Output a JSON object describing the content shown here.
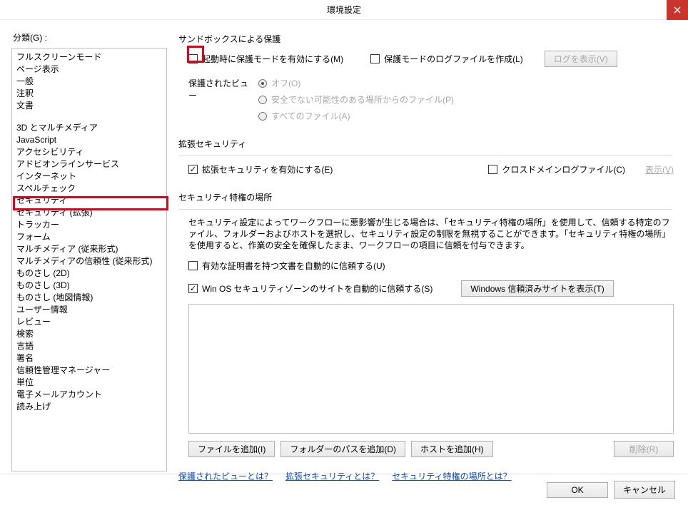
{
  "title": "環境設定",
  "category_label": "分類(G) :",
  "categories_group1": [
    "フルスクリーンモード",
    "ページ表示",
    "一般",
    "注釈",
    "文書"
  ],
  "categories_group2": [
    "3D とマルチメディア",
    "JavaScript",
    "アクセシビリティ",
    "アドビオンラインサービス",
    "インターネット",
    "スペルチェック",
    "セキュリティ",
    "セキュリティ (拡張)",
    "トラッカー",
    "フォーム",
    "マルチメディア (従来形式)",
    "マルチメディアの信頼性 (従来形式)",
    "ものさし (2D)",
    "ものさし (3D)",
    "ものさし (地図情報)",
    "ユーザー情報",
    "レビュー",
    "検索",
    "言語",
    "署名",
    "信頼性管理マネージャー",
    "単位",
    "電子メールアカウント",
    "読み上げ"
  ],
  "sandbox": {
    "title": "サンドボックスによる保護",
    "enable_at_start": "起動時に保護モードを有効にする(M)",
    "create_log": "保護モードのログファイルを作成(L)",
    "view_log_btn": "ログを表示(V)"
  },
  "protected_view": {
    "label": "保護されたビュー",
    "off": "オフ(O)",
    "unsafe": "安全でない可能性のある場所からのファイル(P)",
    "all": "すべてのファイル(A)"
  },
  "ext_sec": {
    "title": "拡張セキュリティ",
    "enable": "拡張セキュリティを有効にする(E)",
    "cross_domain": "クロスドメインログファイル(C)",
    "view_btn": "表示(V)"
  },
  "priv_loc": {
    "title": "セキュリティ特権の場所",
    "desc": "セキュリティ設定によってワークフローに悪影響が生じる場合は、「セキュリティ特権の場所」を使用して、信頼する特定のファイル、フォルダーおよびホストを選択し、セキュリティ設定の制限を無視することができます。「セキュリティ特権の場所」を使用すると、作業の安全を確保したまま、ワークフローの項目に信頼を付与できます。",
    "trust_cert": "有効な証明書を持つ文書を自動的に信頼する(U)",
    "trust_winos": "Win OS セキュリティゾーンのサイトを自動的に信頼する(S)",
    "win_sites_btn": "Windows 信頼済みサイトを表示(T)",
    "add_file": "ファイルを追加(I)",
    "add_folder": "フォルダーのパスを追加(D)",
    "add_host": "ホストを追加(H)",
    "delete": "削除(R)"
  },
  "links": {
    "protected_view": "保護されたビューとは？",
    "ext_sec": "拡張セキュリティとは？",
    "priv_loc": "セキュリティ特権の場所とは？"
  },
  "footer": {
    "ok": "OK",
    "cancel": "キャンセル"
  }
}
